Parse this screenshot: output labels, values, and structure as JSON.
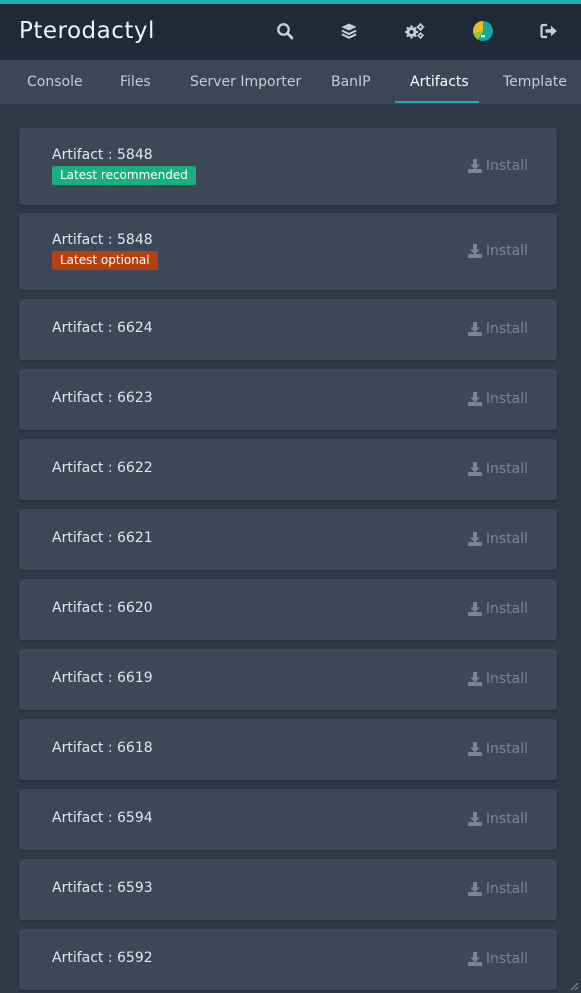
{
  "app": {
    "brand": "Pterodactyl",
    "accent_color": "#1fa9b6"
  },
  "nav_icons": [
    {
      "name": "search-icon"
    },
    {
      "name": "layers-icon"
    },
    {
      "name": "gears-icon"
    },
    {
      "name": "user-avatar-icon"
    },
    {
      "name": "logout-icon"
    }
  ],
  "tabs": [
    {
      "label": "Console",
      "active": false
    },
    {
      "label": "Files",
      "active": false
    },
    {
      "label": "Server Importer",
      "active": false
    },
    {
      "label": "BanIP",
      "active": false
    },
    {
      "label": "Artifacts",
      "active": true
    },
    {
      "label": "Template",
      "active": false
    }
  ],
  "artifacts": [
    {
      "title": "Artifact : 5848",
      "badge": "Latest recommended",
      "badge_color": "#19b07e",
      "install_label": "Install"
    },
    {
      "title": "Artifact : 5848",
      "badge": "Latest optional",
      "badge_color": "#b4410f",
      "install_label": "Install"
    },
    {
      "title": "Artifact : 6624",
      "install_label": "Install"
    },
    {
      "title": "Artifact : 6623",
      "install_label": "Install"
    },
    {
      "title": "Artifact : 6622",
      "install_label": "Install"
    },
    {
      "title": "Artifact : 6621",
      "install_label": "Install"
    },
    {
      "title": "Artifact : 6620",
      "install_label": "Install"
    },
    {
      "title": "Artifact : 6619",
      "install_label": "Install"
    },
    {
      "title": "Artifact : 6618",
      "install_label": "Install"
    },
    {
      "title": "Artifact : 6594",
      "install_label": "Install"
    },
    {
      "title": "Artifact : 6593",
      "install_label": "Install"
    },
    {
      "title": "Artifact : 6592",
      "install_label": "Install"
    }
  ]
}
